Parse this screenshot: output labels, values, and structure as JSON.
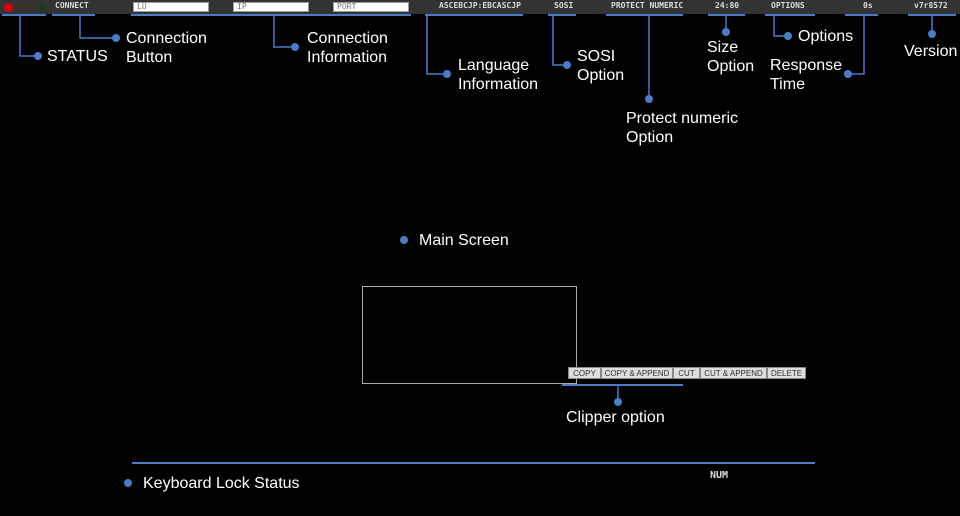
{
  "toolbar": {
    "status_leds": [
      "#e00000",
      "#3a3020",
      "#203a20"
    ],
    "connect": "CONNECT",
    "lu_placeholder": "LU",
    "ip_placeholder": "IP",
    "port_placeholder": "PORT",
    "language": "ASCEBCJP:EBCASCJP",
    "sosi": "SOSI",
    "protect_numeric": "PROTECT NUMERIC",
    "size": "24:80",
    "options": "OPTIONS",
    "response_time": "0s",
    "version": "v7r8572"
  },
  "annotations": {
    "status": "STATUS",
    "connection_button": "Connection\nButton",
    "connection_info": "Connection\nInformation",
    "language_info": "Language\nInformation",
    "sosi": "SOSI\nOption",
    "protect_numeric": "Protect numeric\nOption",
    "size": "Size\nOption",
    "options": "Options",
    "response_time": "Response\nTime",
    "version": "Version",
    "main_screen": "Main Screen",
    "clipper": "Clipper option",
    "keyboard_lock": "Keyboard Lock Status"
  },
  "clipper": {
    "buttons": [
      "COPY",
      "COPY & APPEND",
      "CUT",
      "CUT & APPEND",
      "DELETE"
    ]
  },
  "status_bar": {
    "num": "NUM"
  },
  "colors": {
    "accent": "#4a7cc7",
    "bar": "#333333"
  }
}
